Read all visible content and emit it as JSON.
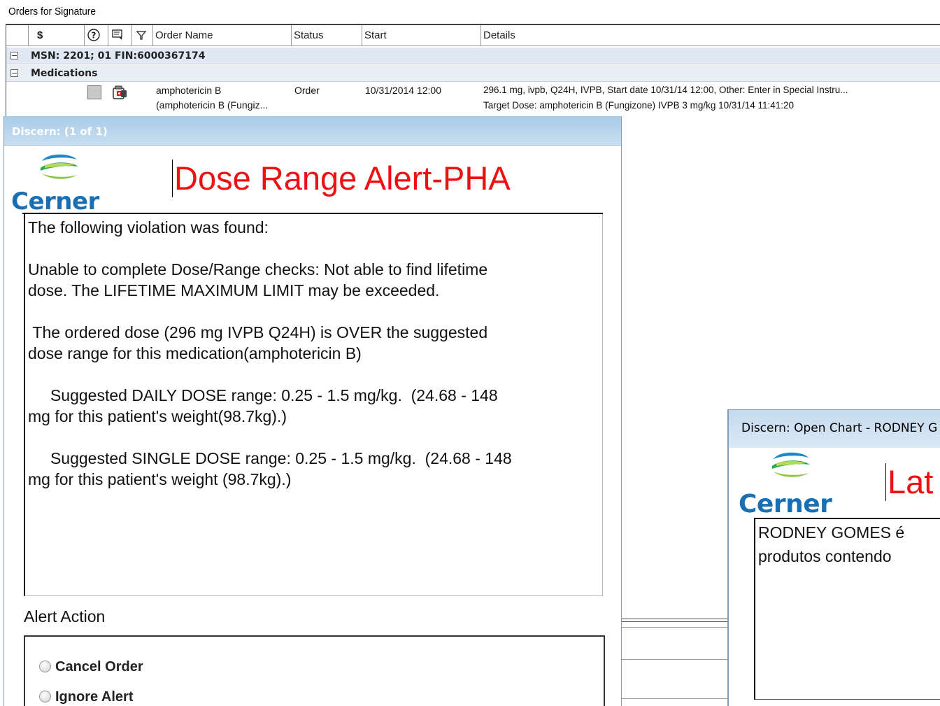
{
  "orders_window": {
    "title": "Orders for Signature",
    "columns": {
      "cost": "$",
      "order_name": "Order Name",
      "status": "Status",
      "start": "Start",
      "details": "Details"
    },
    "encounter_group": "MSN: 2201; 01  FIN:6000367174",
    "category_group": "Medications",
    "order": {
      "name_line1": "amphotericin B",
      "name_line2": "(amphotericin B (Fungiz...",
      "status": "Order",
      "start": "10/31/2014 12:00",
      "details_line1": "296.1 mg, ivpb, Q24H, IVPB, Start date 10/31/14 12:00, Other: Enter in Special Instru...",
      "details_line2": "Target Dose: amphotericin B (Fungizone) IVPB 3 mg/kg  10/31/14 11:41:20"
    }
  },
  "alert_dialog": {
    "title": "Discern: (1 of 1)",
    "logo_text": "Cerner",
    "heading": "Dose Range Alert-PHA",
    "message": {
      "p1": "The following violation was found:",
      "p2": "Unable to complete Dose/Range checks: Not able to find lifetime\ndose. The LIFETIME MAXIMUM LIMIT may be exceeded.",
      "p3": " The ordered dose (296 mg IVPB Q24H) is OVER the suggested\ndose range for this medication(amphotericin B)",
      "p4": "     Suggested DAILY DOSE range: 0.25 - 1.5 mg/kg.  (24.68 - 148\nmg for this patient's weight(98.7kg).)",
      "p5": "     Suggested SINGLE DOSE range: 0.25 - 1.5 mg/kg.  (24.68 - 148\nmg for this patient's weight (98.7kg).)"
    },
    "alert_action_label": "Alert Action",
    "actions": [
      "Cancel Order",
      "Ignore Alert"
    ]
  },
  "chart_dialog": {
    "title": "Discern: Open Chart - RODNEY G",
    "logo_text": "Cerner",
    "heading": "Lat",
    "message_line1": "RODNEY GOMES é",
    "message_line2": "produtos contendo"
  }
}
